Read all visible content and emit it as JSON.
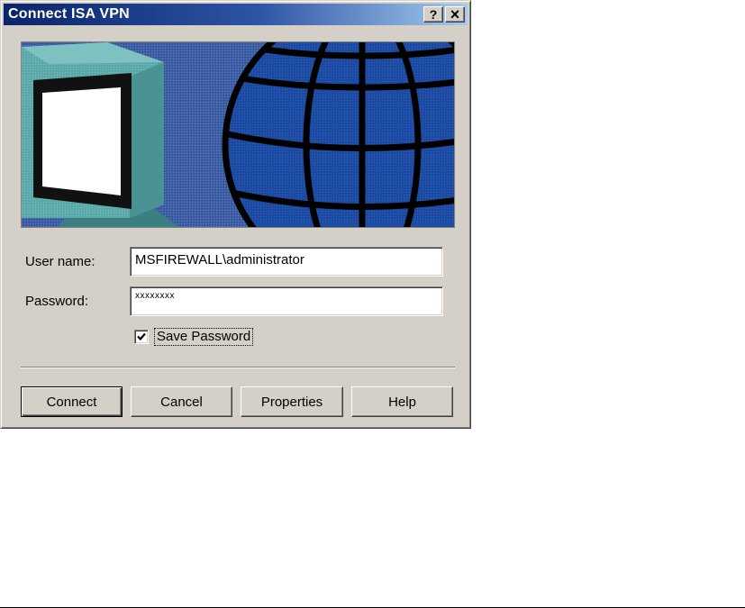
{
  "dialog": {
    "title": "Connect ISA VPN",
    "help_button": "?",
    "close_button": "×"
  },
  "form": {
    "username_label": "User name:",
    "username_value": "MSFIREWALL\\administrator",
    "password_label": "Password:",
    "password_value": "xxxxxxxx",
    "save_password_label": "Save Password",
    "save_password_checked": true
  },
  "buttons": {
    "connect": "Connect",
    "cancel": "Cancel",
    "properties": "Properties",
    "help": "Help"
  },
  "colors": {
    "titlebar_start": "#0a246a",
    "titlebar_end": "#a6caf0",
    "dialog_face": "#d4d0c8",
    "globe_blue": "#1b4aa0",
    "banner_background": "#3e5fa5",
    "monitor_teal": "#5aa8a8"
  },
  "icons": {
    "banner_left": "computer-monitor",
    "banner_right": "globe"
  }
}
